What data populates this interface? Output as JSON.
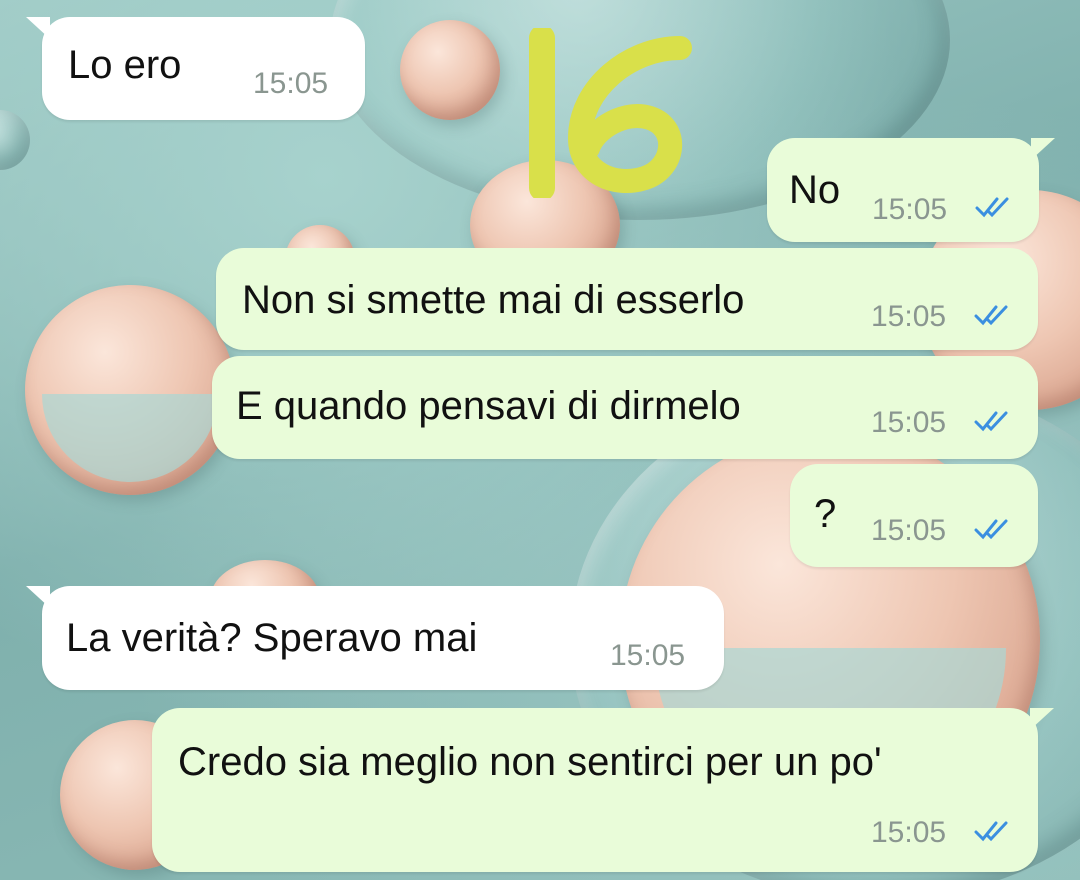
{
  "wallpaper": {
    "description_icon": "bubbles-wallpaper"
  },
  "annotation": {
    "text": "16",
    "color": "#d9e04a"
  },
  "colors": {
    "incoming_bubble": "#ffffff",
    "outgoing_bubble": "#e9fcd9",
    "time_text": "#8a9690",
    "read_ticks": "#3b8fe0"
  },
  "messages": [
    {
      "direction": "in",
      "text": "Lo ero",
      "time": "15:05"
    },
    {
      "direction": "out",
      "text": "No",
      "time": "15:05",
      "status_icon": "double-check-read-icon"
    },
    {
      "direction": "out",
      "text": "Non si smette mai di esserlo",
      "time": "15:05",
      "status_icon": "double-check-read-icon"
    },
    {
      "direction": "out",
      "text": "E quando pensavi di dirmelo",
      "time": "15:05",
      "status_icon": "double-check-read-icon"
    },
    {
      "direction": "out",
      "text": "?",
      "time": "15:05",
      "status_icon": "double-check-read-icon"
    },
    {
      "direction": "in",
      "text": "La verità? Speravo mai",
      "time": "15:05"
    },
    {
      "direction": "out",
      "text": "Credo sia meglio non sentirci per un po'",
      "time": "15:05",
      "status_icon": "double-check-read-icon"
    }
  ]
}
